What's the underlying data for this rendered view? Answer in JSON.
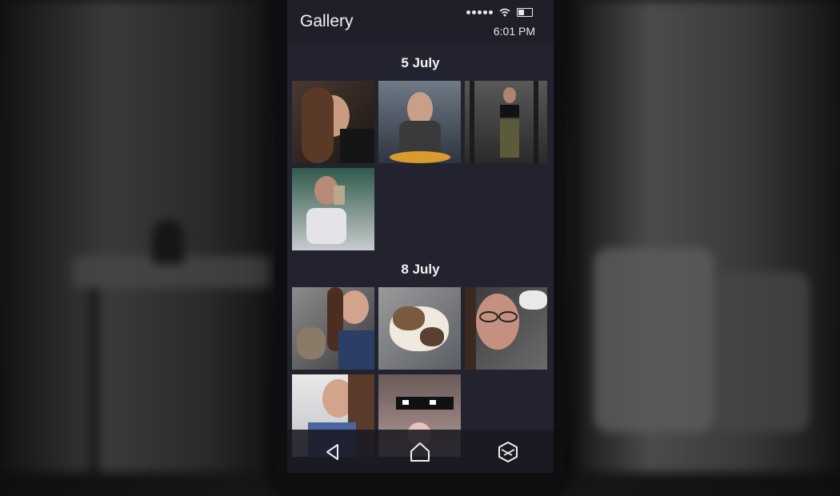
{
  "app": {
    "title": "Gallery"
  },
  "status_bar": {
    "time": "6:01 PM",
    "signal_dots": 5,
    "battery_level": 0.4
  },
  "accent_color": "#e8d931",
  "gallery": {
    "sections": [
      {
        "date": "5 July",
        "photo_count": 4
      },
      {
        "date": "8 July",
        "photo_count": 5
      }
    ]
  },
  "nav": {
    "icons": [
      "back-icon",
      "home-icon",
      "app-switcher-icon"
    ]
  }
}
